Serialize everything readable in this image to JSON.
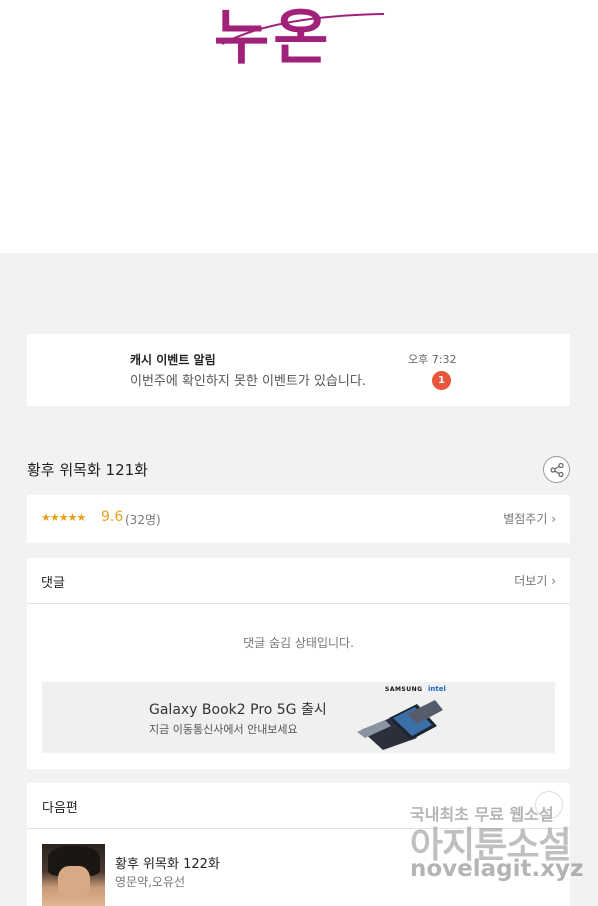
{
  "logo": {
    "text": "누온"
  },
  "notification": {
    "title": "캐시 이벤트 알림",
    "message": "이번주에 확인하지 못한 이벤트가 있습니다.",
    "time": "오후 7:32",
    "badge_count": "1"
  },
  "episode": {
    "title": "황후 위목화 121화",
    "share_icon": "share-icon"
  },
  "rating": {
    "stars": "★★★★★",
    "score": "9.6",
    "count": "(32명)",
    "rate_link": "별점주기 ›"
  },
  "comments": {
    "heading": "댓글",
    "more_link": "더보기 ›",
    "hidden_message": "댓글 숨김 상태입니다."
  },
  "ad": {
    "title": "Galaxy Book2 Pro 5G 출시",
    "subtitle": "지금 이동통신사에서 안내보세요",
    "brand_samsung": "SAMSUNG",
    "brand_intel": "intel"
  },
  "next_episode": {
    "heading": "다음편",
    "title": "황후 위목화 122화",
    "authors": "영문약,오유선"
  },
  "watermark": {
    "line1": "국내최초 무료 웹소설",
    "line2": "아지툰소설",
    "line3": "novelagit.xyz"
  },
  "colors": {
    "accent": "#e9a11a",
    "badge": "#e8553b",
    "logo": "#a0207a"
  }
}
